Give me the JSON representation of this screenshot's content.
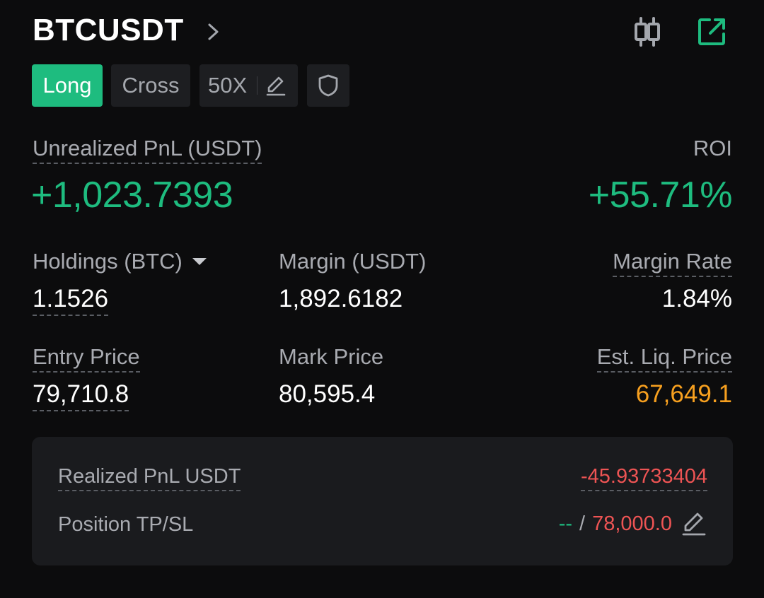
{
  "header": {
    "symbol": "BTCUSDT",
    "icons": [
      "chevron-right-icon",
      "candlestick-chart-icon",
      "share-external-icon"
    ]
  },
  "tags": {
    "side": "Long",
    "margin_mode": "Cross",
    "leverage": "50X",
    "icons": [
      "edit-pencil-icon",
      "shield-icon"
    ]
  },
  "pnl": {
    "unrealized_label": "Unrealized PnL (USDT)",
    "unrealized_value": "+1,023.7393",
    "roi_label": "ROI",
    "roi_value": "+55.71%"
  },
  "stats": {
    "holdings_label": "Holdings (BTC)",
    "holdings_value": "1.1526",
    "margin_label": "Margin (USDT)",
    "margin_value": "1,892.6182",
    "margin_rate_label": "Margin Rate",
    "margin_rate_value": "1.84%",
    "entry_price_label": "Entry Price",
    "entry_price_value": "79,710.8",
    "mark_price_label": "Mark Price",
    "mark_price_value": "80,595.4",
    "liq_price_label": "Est. Liq. Price",
    "liq_price_value": "67,649.1"
  },
  "card": {
    "realized_label": "Realized PnL USDT",
    "realized_value": "-45.93733404",
    "tpsl_label": "Position TP/SL",
    "tp_value": "--",
    "tpsl_separator": "/",
    "sl_value": "78,000.0"
  },
  "colors": {
    "accent_green": "#1ebc7f",
    "loss_red": "#ee5454",
    "liq_orange": "#f7a01f",
    "background": "#0c0c0d",
    "card": "#1a1b1e"
  }
}
